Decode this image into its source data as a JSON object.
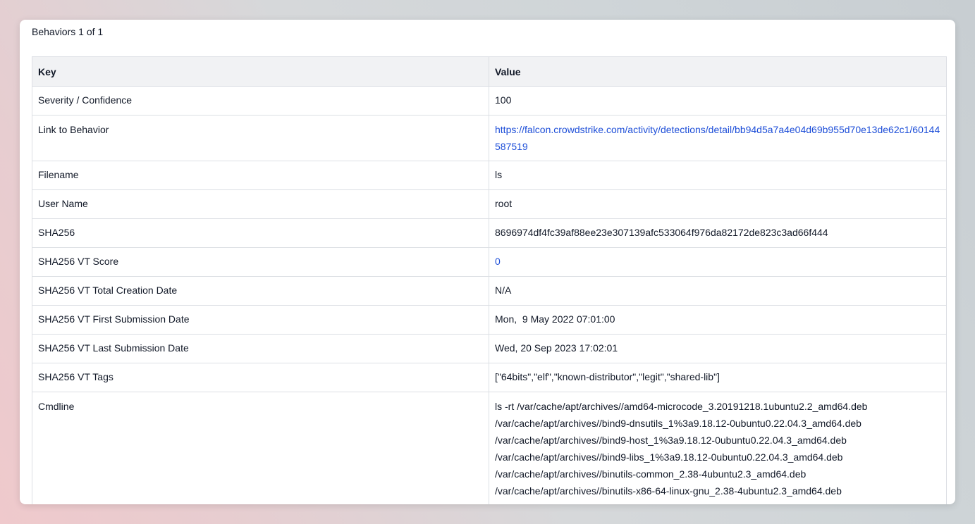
{
  "panel": {
    "title": "Behaviors 1 of 1"
  },
  "table": {
    "headers": {
      "key": "Key",
      "value": "Value"
    },
    "rows": [
      {
        "key": "Severity / Confidence",
        "value": "100"
      },
      {
        "key": "Link to Behavior",
        "value": "https://falcon.crowdstrike.com/activity/detections/detail/bb94d5a7a4e04d69b955d70e13de62c1/60144587519"
      },
      {
        "key": "Filename",
        "value": "ls"
      },
      {
        "key": "User Name",
        "value": "root"
      },
      {
        "key": "SHA256",
        "value": "8696974df4fc39af88ee23e307139afc533064f976da82172de823c3ad66f444"
      },
      {
        "key": "SHA256 VT Score",
        "value": "0"
      },
      {
        "key": "SHA256 VT Total Creation Date",
        "value": "N/A"
      },
      {
        "key": "SHA256 VT First Submission Date",
        "value": "Mon,  9 May 2022 07:01:00"
      },
      {
        "key": "SHA256 VT Last Submission Date",
        "value": "Wed, 20 Sep 2023 17:02:01"
      },
      {
        "key": "SHA256 VT Tags",
        "value": "[\"64bits\",\"elf\",\"known-distributor\",\"legit\",\"shared-lib\"]"
      },
      {
        "key": "Cmdline",
        "value_lines": [
          "ls -rt /var/cache/apt/archives//amd64-microcode_3.20191218.1ubuntu2.2_amd64.deb",
          "/var/cache/apt/archives//bind9-dnsutils_1%3a9.18.12-0ubuntu0.22.04.3_amd64.deb",
          "/var/cache/apt/archives//bind9-host_1%3a9.18.12-0ubuntu0.22.04.3_amd64.deb",
          "/var/cache/apt/archives//bind9-libs_1%3a9.18.12-0ubuntu0.22.04.3_amd64.deb",
          "/var/cache/apt/archives//binutils-common_2.38-4ubuntu2.3_amd64.deb",
          "/var/cache/apt/archives//binutils-x86-64-linux-gnu_2.38-4ubuntu2.3_amd64.deb"
        ]
      }
    ]
  },
  "colors": {
    "link": "#1d4ed8",
    "header_bg": "#f1f2f4",
    "border": "#dcdfe4"
  }
}
